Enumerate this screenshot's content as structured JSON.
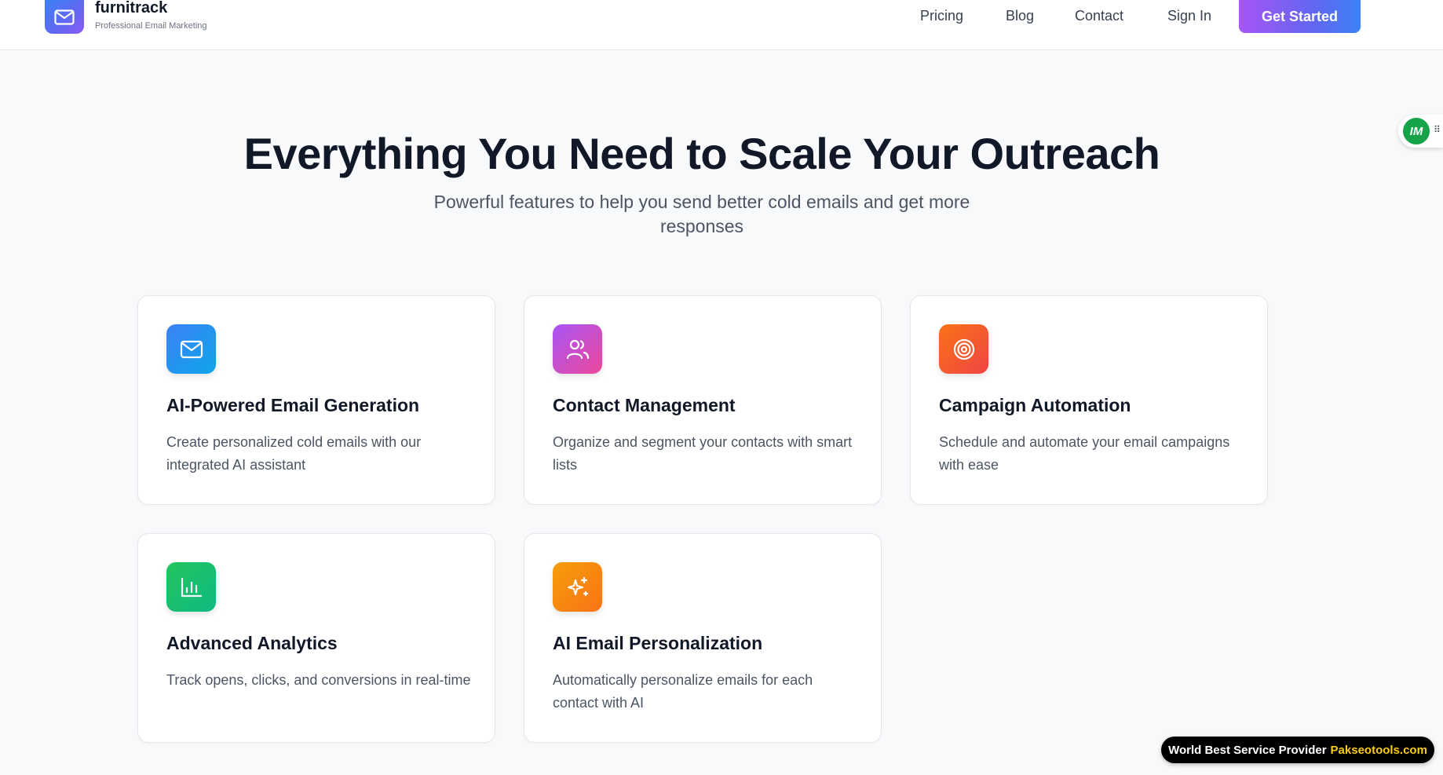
{
  "header": {
    "brand": "furnitrack",
    "tagline": "Professional Email Marketing",
    "nav": [
      {
        "label": "Pricing"
      },
      {
        "label": "Blog"
      },
      {
        "label": "Contact"
      },
      {
        "label": "Sign In"
      }
    ],
    "cta_label": "Get Started"
  },
  "hero": {
    "title": "Everything You Need to Scale Your Outreach",
    "subtitle": "Powerful features to help you send better cold emails and get more responses"
  },
  "features": [
    {
      "icon": "mail-icon",
      "title": "AI-Powered Email Generation",
      "description": "Create personalized cold emails with our integrated AI assistant",
      "color": "#3b82f6"
    },
    {
      "icon": "users-icon",
      "title": "Contact Management",
      "description": "Organize and segment your contacts with smart lists",
      "color": "#a855f7"
    },
    {
      "icon": "target-icon",
      "title": "Campaign Automation",
      "description": "Schedule and automate your email campaigns with ease",
      "color": "#f97316"
    },
    {
      "icon": "bar-chart-icon",
      "title": "Advanced Analytics",
      "description": "Track opens, clicks, and conversions in real-time",
      "color": "#22c55e"
    },
    {
      "icon": "sparkles-icon",
      "title": "AI Email Personalization",
      "description": "Automatically personalize emails for each contact with AI",
      "color": "#f59e0b"
    }
  ],
  "widgets": {
    "side_badge": "IM",
    "promo_text": "World Best Service Provider",
    "promo_highlight": "Pakseotools.com"
  }
}
